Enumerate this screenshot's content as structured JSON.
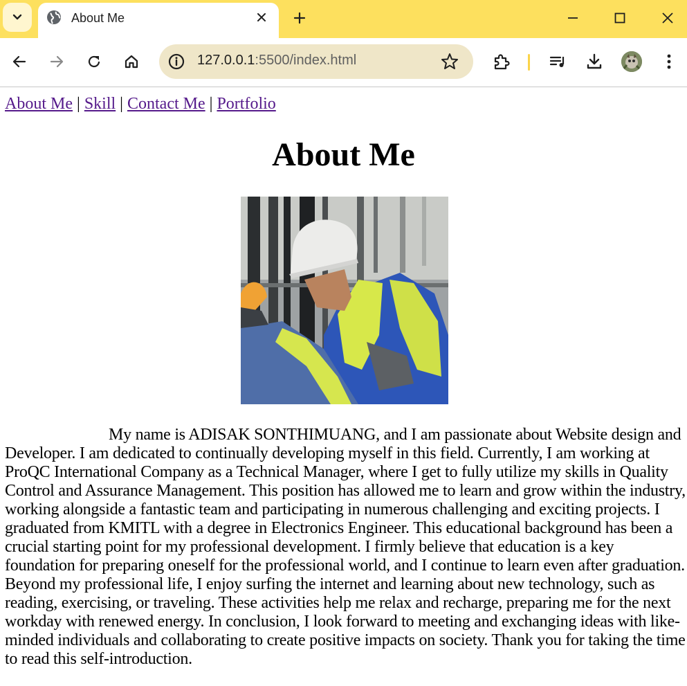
{
  "browser": {
    "tab_title": "About Me",
    "url_host": "127.0.0.1",
    "url_rest": ":5500/index.html"
  },
  "nav": {
    "links": [
      "About Me",
      "Skill",
      "Contact Me",
      "Portfolio"
    ],
    "separator": "|"
  },
  "main": {
    "heading": "About Me",
    "paragraph": "My name is ADISAK SONTHIMUANG, and I am passionate about Website design and Developer. I am dedicated to continually developing myself in this field. Currently, I am working at ProQC International Company as a Technical Manager, where I get to fully utilize my skills in Quality Control and Assurance Management. This position has allowed me to learn and grow within the industry, working alongside a fantastic team and participating in numerous challenging and exciting projects. I graduated from KMITL with a degree in Electronics Engineer. This educational background has been a crucial starting point for my professional development. I firmly believe that education is a key foundation for preparing oneself for the professional world, and I continue to learn even after graduation. Beyond my professional life, I enjoy surfing the internet and learning about new technology, such as reading, exercising, or traveling. These activities help me relax and recharge, preparing me for the next workday with renewed energy. In conclusion, I look forward to meeting and exchanging ideas with like-minded individuals and collaborating to create positive impacts on society. Thank you for taking the time to read this self-introduction."
  },
  "colors": {
    "tabstrip": "#fde05e",
    "link": "#551a8b",
    "text": "#000000"
  },
  "icons": [
    "tab-search-icon",
    "globe-icon",
    "close-icon",
    "plus-icon",
    "minimize-icon",
    "maximize-icon",
    "window-close-icon",
    "back-icon",
    "forward-icon",
    "reload-icon",
    "home-icon",
    "site-info-icon",
    "star-icon",
    "extensions-icon",
    "media-icon",
    "download-icon",
    "menu-icon"
  ]
}
